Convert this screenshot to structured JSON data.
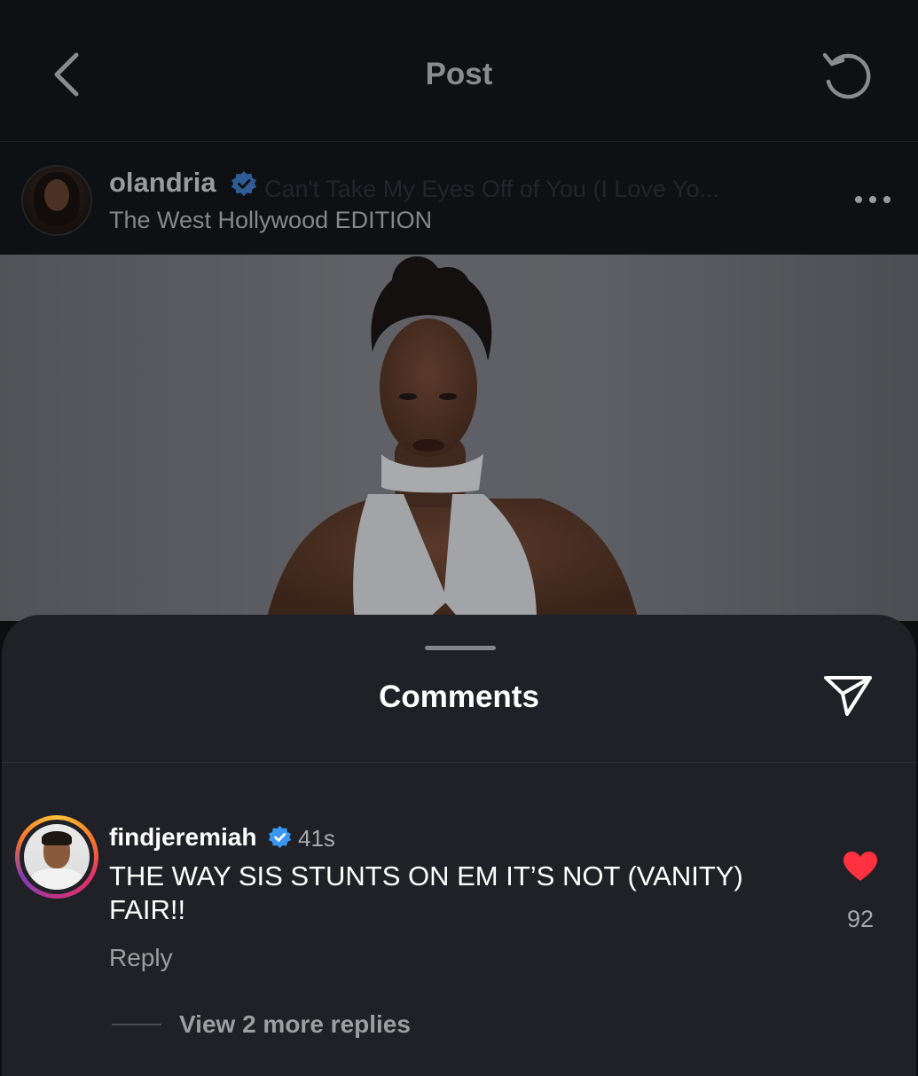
{
  "nav": {
    "title": "Post",
    "back_icon": "chevron-left-icon",
    "refresh_icon": "refresh-icon"
  },
  "post": {
    "username": "olandria",
    "verified": true,
    "music": "Can't Take My Eyes Off of You (I Love Yo...",
    "location": "The West Hollywood EDITION",
    "more_icon": "more-horizontal-icon"
  },
  "comments_sheet": {
    "title": "Comments",
    "share_icon": "send-icon",
    "comments": [
      {
        "username": "findjeremiah",
        "verified": true,
        "time": "41s",
        "text": "THE WAY SIS STUNTS ON EM IT’S NOT (VANITY) FAIR!!",
        "reply_label": "Reply",
        "likes": "92",
        "liked": true,
        "view_replies_label": "View 2 more replies"
      }
    ]
  },
  "colors": {
    "background": "#0d0e10",
    "sheet": "#202126",
    "verified_blue": "#3897f0",
    "like_red": "#ff3040"
  }
}
